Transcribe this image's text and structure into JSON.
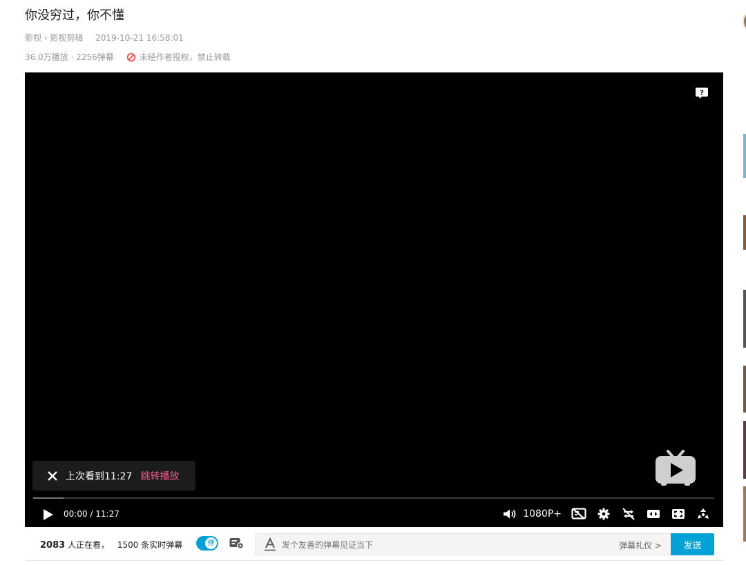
{
  "video": {
    "title": "你没穷过，你不懂",
    "breadcrumb": "影视 › 影视剪辑",
    "publish_time": "2019-10-21 16:58:01",
    "stats": "36.0万播放 · 2256弹幕",
    "copyright_notice": "未经作者授权，禁止转载"
  },
  "player": {
    "resume_text": "上次看到11:27",
    "resume_jump": "跳转播放",
    "current_time": "00:00",
    "duration": "11:27",
    "time_separator": " / ",
    "quality": "1080P+",
    "progress_fraction": 0.045,
    "icons": [
      "help-icon",
      "play-icon",
      "volume-icon",
      "danmaku-hide-icon",
      "settings-icon",
      "loop-off-icon",
      "widescreen-icon",
      "web-fullscreen-icon",
      "fullscreen-icon"
    ]
  },
  "danmaku": {
    "viewers_count": "2083",
    "viewers_label": "人正在看，",
    "live_count": "1500",
    "live_label": "条实时弹幕",
    "toggle_glyph": "弹",
    "input_placeholder": "发个友善的弹幕见证当下",
    "etiquette": "弹幕礼仪 >",
    "send": "发送"
  },
  "colors": {
    "accent": "#00a1d6",
    "pink": "#f25d8e",
    "warning": "#f25d5d"
  }
}
